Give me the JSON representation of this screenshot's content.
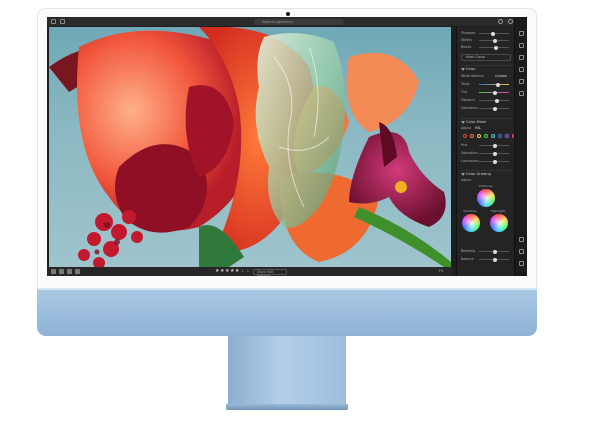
{
  "toolbar": {
    "search_placeholder": "Search Lightroom"
  },
  "photo": {
    "subject": "flower-art-photo"
  },
  "filmstrip": {
    "rating": "★★★★★",
    "ratio": "1 : 1",
    "settings_label": "Show Edit Settings",
    "zoom_label": "Fit"
  },
  "panel": {
    "top_sliders": [
      {
        "label": "Shadows",
        "value": 0.45
      },
      {
        "label": "Whites",
        "value": 0.5
      },
      {
        "label": "Blacks",
        "value": 0.55
      }
    ],
    "masking_label": "Mask Group",
    "color_header": "Color",
    "wb_label": "White Balance",
    "wb_value": "Custom",
    "color_sliders": [
      {
        "label": "Temp",
        "value": 0.6
      },
      {
        "label": "Tint",
        "value": 0.5
      },
      {
        "label": "Vibrance",
        "value": 0.55
      },
      {
        "label": "Saturation",
        "value": 0.5
      }
    ],
    "color_mixer_header": "Color Mixer",
    "mixer_label": "Adjust",
    "mixer_mode": "HSL",
    "mixer_sliders": [
      {
        "label": "Hue",
        "value": 0.5
      },
      {
        "label": "Saturation",
        "value": 0.5
      },
      {
        "label": "Luminance",
        "value": 0.5
      }
    ],
    "mixer_colors": [
      "#e0433b",
      "#f07a2a",
      "#e8d23a",
      "#4bd04b",
      "#3fd0c8",
      "#3b78e8",
      "#a855e8",
      "#e84bc0"
    ],
    "grading_header": "Color Grading",
    "grading_sub": "Adjust",
    "midtones_label": "Midtones",
    "shadows_label": "Shadows",
    "highlights_label": "Highlights",
    "bottom_sliders": [
      {
        "label": "Blending",
        "value": 0.5
      },
      {
        "label": "Balance",
        "value": 0.5
      }
    ]
  }
}
